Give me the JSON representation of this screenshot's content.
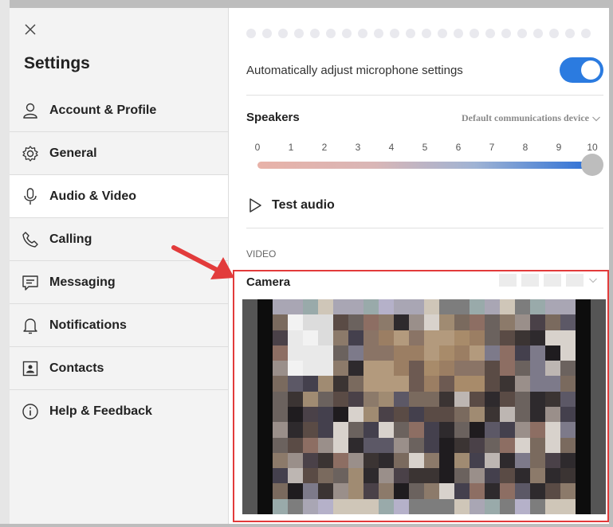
{
  "sidebar": {
    "title": "Settings",
    "close_icon": "close-icon",
    "items": [
      {
        "key": "account",
        "label": "Account & Profile",
        "icon": "person-icon"
      },
      {
        "key": "general",
        "label": "General",
        "icon": "gear-icon"
      },
      {
        "key": "audio-video",
        "label": "Audio & Video",
        "icon": "microphone-icon",
        "active": true
      },
      {
        "key": "calling",
        "label": "Calling",
        "icon": "phone-icon"
      },
      {
        "key": "messaging",
        "label": "Messaging",
        "icon": "chat-icon"
      },
      {
        "key": "notifications",
        "label": "Notifications",
        "icon": "bell-icon"
      },
      {
        "key": "contacts",
        "label": "Contacts",
        "icon": "contact-card-icon"
      },
      {
        "key": "help",
        "label": "Help & Feedback",
        "icon": "info-icon"
      }
    ]
  },
  "audio": {
    "auto_adjust_label": "Automatically adjust microphone settings",
    "auto_adjust_on": true,
    "speakers_label": "Speakers",
    "speakers_device": "Default communications device",
    "volume_ticks": [
      "0",
      "1",
      "2",
      "3",
      "4",
      "5",
      "6",
      "7",
      "8",
      "9",
      "10"
    ],
    "volume_value": 10,
    "test_audio_label": "Test audio"
  },
  "video": {
    "section_label": "VIDEO",
    "camera_label": "Camera"
  },
  "colors": {
    "accent": "#2b7be0",
    "callout": "#e23b3b"
  }
}
